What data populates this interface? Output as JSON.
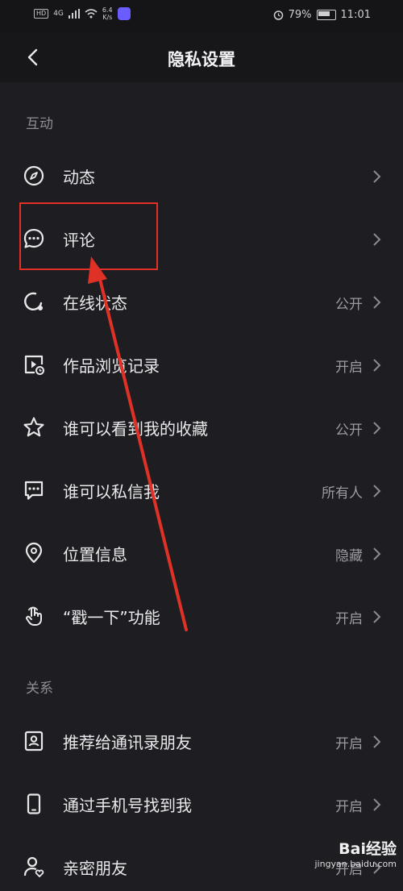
{
  "status_bar": {
    "hd": "HD",
    "network": "4G",
    "speed_top": "6.4",
    "speed_bottom": "K/s",
    "battery": "79%",
    "time": "11:01"
  },
  "header": {
    "title": "隐私设置"
  },
  "sections": [
    {
      "title": "互动",
      "items": [
        {
          "label": "动态",
          "value": ""
        },
        {
          "label": "评论",
          "value": ""
        },
        {
          "label": "在线状态",
          "value": "公开"
        },
        {
          "label": "作品浏览记录",
          "value": "开启"
        },
        {
          "label": "谁可以看到我的收藏",
          "value": "公开"
        },
        {
          "label": "谁可以私信我",
          "value": "所有人"
        },
        {
          "label": "位置信息",
          "value": "隐藏"
        },
        {
          "label": "“戳一下”功能",
          "value": "开启"
        }
      ]
    },
    {
      "title": "关系",
      "items": [
        {
          "label": "推荐给通讯录朋友",
          "value": "开启"
        },
        {
          "label": "通过手机号找到我",
          "value": "开启"
        },
        {
          "label": "亲密朋友",
          "value": "开启"
        }
      ]
    }
  ],
  "watermark": {
    "main": "Bai经验",
    "sub": "jingyan.baidu.com"
  },
  "colors": {
    "background": "#1e1e22",
    "highlight": "#e03127"
  }
}
